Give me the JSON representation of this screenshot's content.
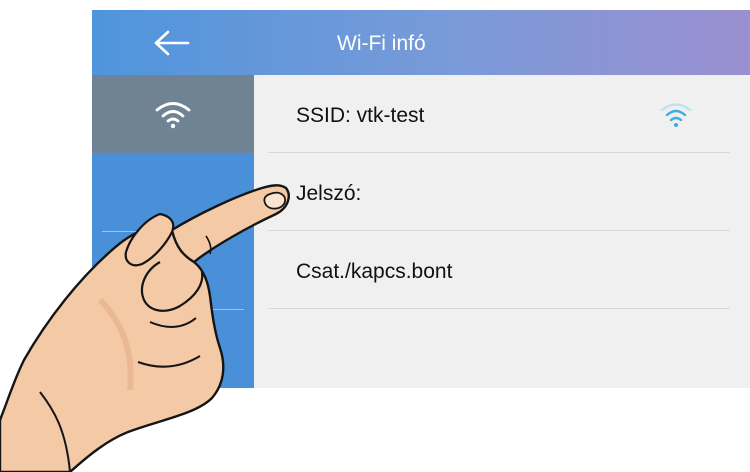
{
  "header": {
    "title": "Wi-Fi infó",
    "back_icon": "arrow-left-icon"
  },
  "sidebar": {
    "items": [
      {
        "icon": "wifi-icon",
        "active": true
      }
    ]
  },
  "wifi_info": {
    "rows": [
      {
        "label": "SSID: vtk-test",
        "icon": "wifi-signal-icon"
      },
      {
        "label": "Jelszó:"
      },
      {
        "label": "Csat./kapcs.bont"
      }
    ]
  },
  "colors": {
    "header_gradient_start": "#4f95dc",
    "header_gradient_end": "#9a8fd0",
    "sidebar": "#4a90d9",
    "sidebar_active": "#6f8394",
    "content_bg": "#f0f0f0",
    "signal_accent": "#3aaee0"
  },
  "overlay": {
    "icon": "pointing-hand-icon"
  }
}
